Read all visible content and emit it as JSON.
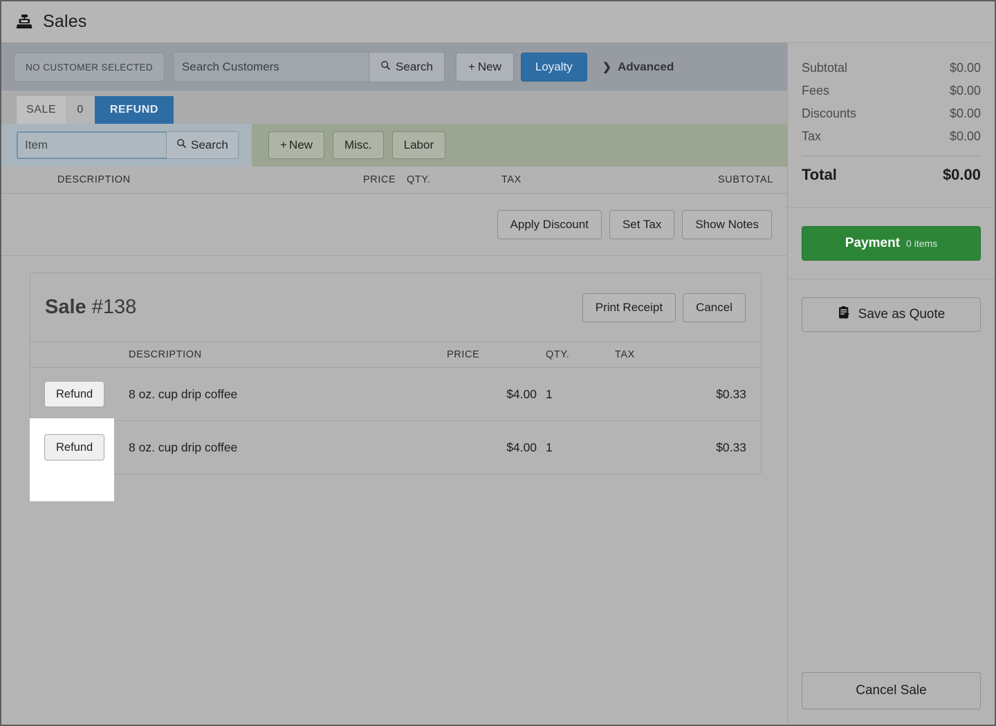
{
  "header": {
    "icon": "cash-register-icon",
    "title": "Sales"
  },
  "customer_bar": {
    "no_customer_label": "NO CUSTOMER SELECTED",
    "search_placeholder": "Search Customers",
    "search_value": "",
    "search_button": "Search",
    "new_button": "New",
    "loyalty_button": "Loyalty",
    "advanced_link": "Advanced"
  },
  "tabs": {
    "sale_label": "SALE",
    "sale_count": "0",
    "refund_label": "REFUND",
    "active": "REFUND"
  },
  "item_bar": {
    "item_placeholder": "Item",
    "item_value": "",
    "search_button": "Search",
    "new_button": "New",
    "misc_button": "Misc.",
    "labor_button": "Labor"
  },
  "line_items_header": {
    "description": "DESCRIPTION",
    "price": "PRICE",
    "qty": "QTY.",
    "tax": "TAX",
    "subtotal": "SUBTOTAL"
  },
  "line_item_actions": {
    "apply_discount": "Apply Discount",
    "set_tax": "Set Tax",
    "show_notes": "Show Notes"
  },
  "sale_card": {
    "title_word": "Sale",
    "title_number": "#138",
    "print_receipt": "Print Receipt",
    "cancel": "Cancel",
    "columns": {
      "action": "",
      "description": "DESCRIPTION",
      "price": "PRICE",
      "qty": "QTY.",
      "tax": "TAX"
    },
    "rows": [
      {
        "action": "Refund",
        "description": "8 oz. cup drip coffee",
        "price": "$4.00",
        "qty": "1",
        "tax": "$0.33"
      },
      {
        "action": "Refund",
        "description": "8 oz. cup drip coffee",
        "price": "$4.00",
        "qty": "1",
        "tax": "$0.33"
      }
    ]
  },
  "sidebar": {
    "totals": [
      {
        "label": "Subtotal",
        "value": "$0.00"
      },
      {
        "label": "Fees",
        "value": "$0.00"
      },
      {
        "label": "Discounts",
        "value": "$0.00"
      },
      {
        "label": "Tax",
        "value": "$0.00"
      }
    ],
    "total_label": "Total",
    "total_value": "$0.00",
    "payment_label": "Payment",
    "payment_items": "0 items",
    "save_quote_label": "Save as Quote",
    "cancel_sale_label": "Cancel Sale"
  },
  "colors": {
    "background": "#b4b4b4",
    "toolbar": "#979ca3",
    "accent_blue": "#2e6da4",
    "item_bar_green": "#9ba592",
    "item_bar_blue": "#a9b5bd",
    "payment_green": "#2d8538",
    "highlight_white": "#ffffff"
  }
}
